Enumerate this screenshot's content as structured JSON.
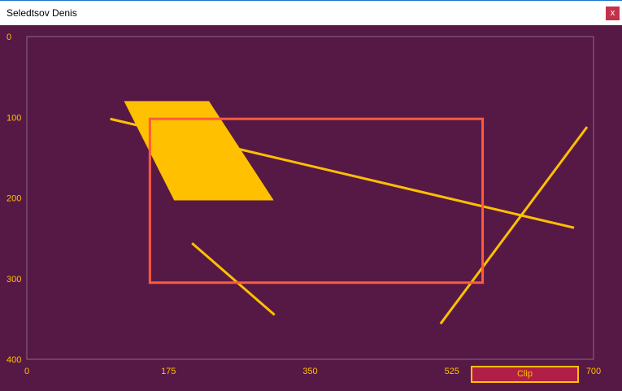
{
  "window": {
    "title": "Seledtsov Denis",
    "close_label": "x"
  },
  "colors": {
    "background": "#561945",
    "accent": "#ffc000",
    "clip_rect": "#ff5a3c",
    "button_fill": "#b01f45"
  },
  "axes": {
    "x_ticks": [
      "0",
      "175",
      "350",
      "525",
      "700"
    ],
    "y_ticks": [
      "0",
      "100",
      "200",
      "300",
      "400"
    ],
    "x_range": [
      0,
      700
    ],
    "y_range": [
      0,
      400
    ]
  },
  "scene": {
    "polygon": [
      [
        120,
        80
      ],
      [
        225,
        80
      ],
      [
        305,
        203
      ],
      [
        182,
        203
      ]
    ],
    "clip_window": {
      "x1": 152,
      "y1": 102,
      "x2": 563,
      "y2": 305
    },
    "segments": [
      {
        "from": [
          103,
          102
        ],
        "to": [
          676,
          237
        ]
      },
      {
        "from": [
          204,
          256
        ],
        "to": [
          306,
          345
        ]
      },
      {
        "from": [
          511,
          356
        ],
        "to": [
          692,
          112
        ]
      }
    ]
  },
  "controls": {
    "clip_label": "Clip"
  }
}
